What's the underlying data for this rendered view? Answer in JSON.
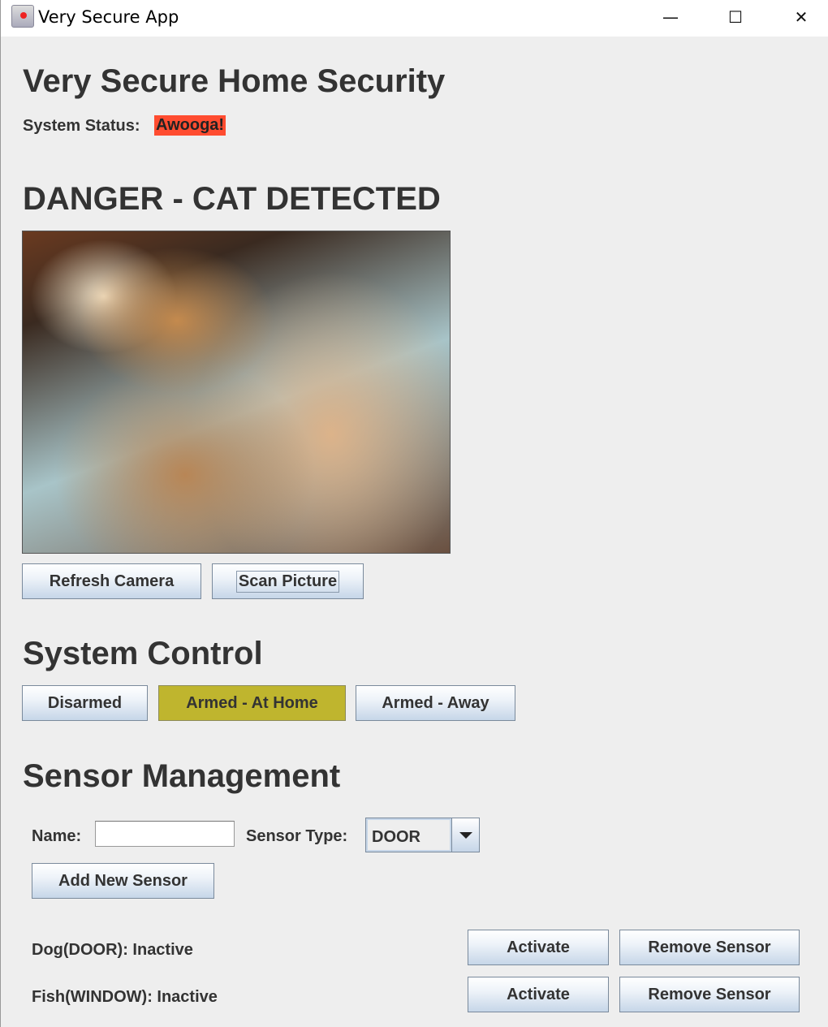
{
  "window": {
    "title": "Very Secure App",
    "minimize": "—",
    "maximize": "☐",
    "close": "✕"
  },
  "header": {
    "title": "Very Secure Home Security",
    "status_label": "System Status:",
    "status_value": "Awooga!",
    "status_color": "#ff4c30"
  },
  "camera": {
    "heading": "DANGER - CAT DETECTED",
    "refresh_label": "Refresh Camera",
    "scan_label": "Scan Picture"
  },
  "control": {
    "heading": "System Control",
    "modes": [
      {
        "label": "Disarmed"
      },
      {
        "label": "Armed - At Home",
        "selected": true,
        "color": "#bfb52e"
      },
      {
        "label": "Armed - Away"
      }
    ]
  },
  "sensors": {
    "heading": "Sensor Management",
    "name_label": "Name:",
    "name_value": "",
    "type_label": "Sensor Type:",
    "type_value": "DOOR",
    "add_label": "Add New Sensor",
    "items": [
      {
        "text": "Dog(DOOR): Inactive",
        "activate": "Activate",
        "remove": "Remove Sensor"
      },
      {
        "text": "Fish(WINDOW): Inactive",
        "activate": "Activate",
        "remove": "Remove Sensor"
      }
    ]
  }
}
